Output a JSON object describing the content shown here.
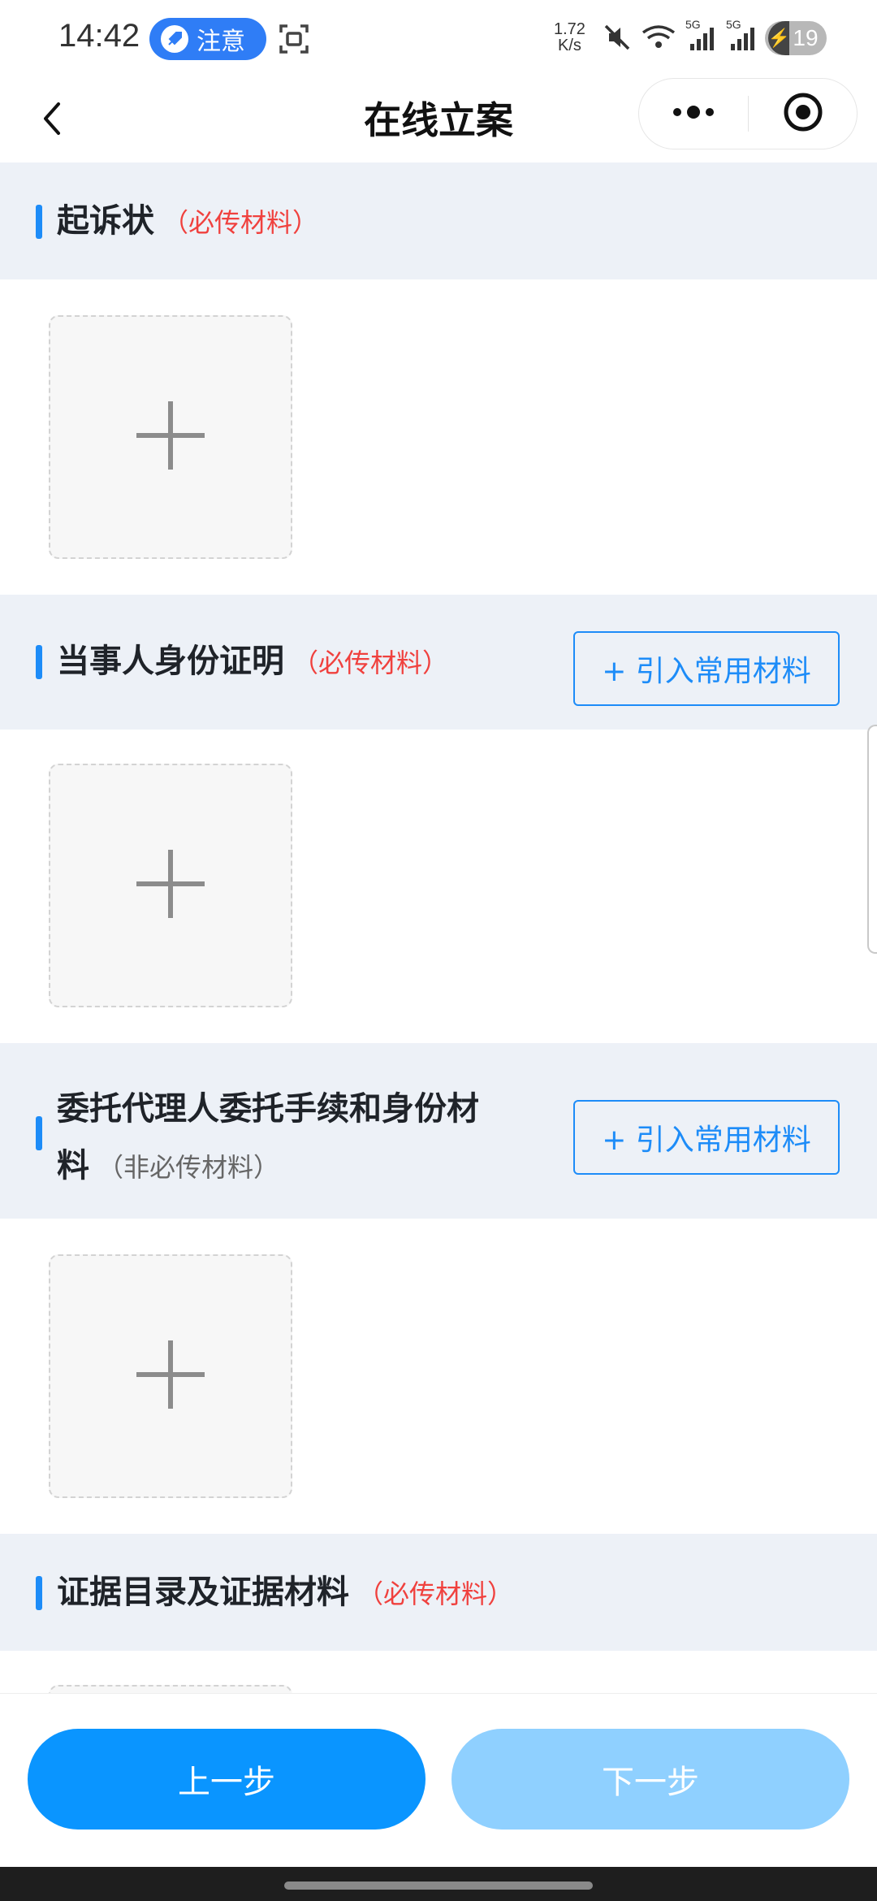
{
  "status_bar": {
    "time": "14:42",
    "notice_label": "注意",
    "net_speed_value": "1.72",
    "net_speed_unit": "K/s",
    "signal_label_1": "5G",
    "signal_label_2": "5G",
    "battery_level": "19",
    "icons": [
      "screenshot-icon",
      "mute-icon",
      "wifi-icon",
      "signal-icon",
      "battery-icon"
    ]
  },
  "nav": {
    "title": "在线立案",
    "back_icon": "chevron-left-icon",
    "more_icon": "more-dots-icon",
    "close_icon": "target-close-icon"
  },
  "sections": [
    {
      "title": "起诉状",
      "tag": "（必传材料）",
      "required": true
    },
    {
      "title": "当事人身份证明",
      "tag": "（必传材料）",
      "required": true,
      "import_label": "+ 引入常用材料"
    },
    {
      "title_line1": "委托代理人委托手续和身份材",
      "title_line2": "料",
      "tag": "（非必传材料）",
      "required": false,
      "import_label": "+ 引入常用材料"
    },
    {
      "title": "证据目录及证据材料",
      "tag": "（必传材料）",
      "required": true
    }
  ],
  "buttons": {
    "prev": "上一步",
    "next": "下一步"
  },
  "colors": {
    "accent": "#1d8cf8",
    "required_tag": "#f0413e",
    "section_bg": "#edf1f7",
    "next_disabled": "#8fd0ff",
    "prev_enabled": "#0a95ff"
  }
}
